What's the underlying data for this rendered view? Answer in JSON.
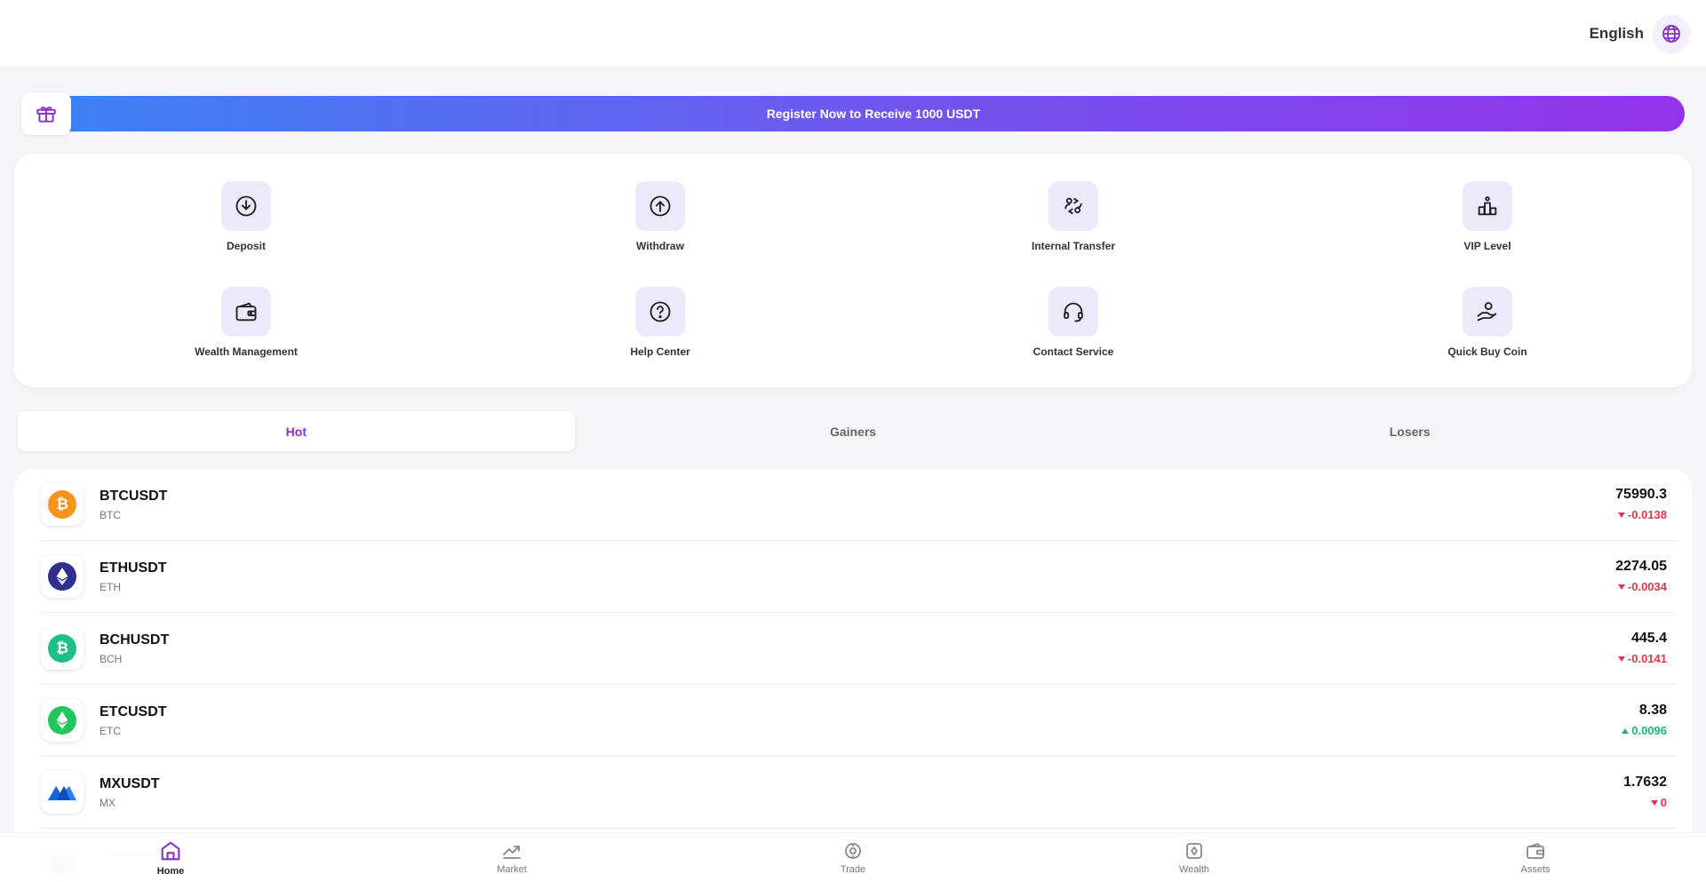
{
  "header": {
    "language": "English"
  },
  "banner": {
    "text": "Register Now to Receive 1000 USDT"
  },
  "actions": [
    {
      "label": "Deposit",
      "icon": "deposit-icon"
    },
    {
      "label": "Withdraw",
      "icon": "withdraw-icon"
    },
    {
      "label": "Internal Transfer",
      "icon": "transfer-icon"
    },
    {
      "label": "VIP Level",
      "icon": "vip-icon"
    },
    {
      "label": "Wealth Management",
      "icon": "wallet-icon"
    },
    {
      "label": "Help Center",
      "icon": "help-icon"
    },
    {
      "label": "Contact Service",
      "icon": "headset-icon"
    },
    {
      "label": "Quick Buy Coin",
      "icon": "buy-coin-icon"
    }
  ],
  "tabs": [
    {
      "label": "Hot",
      "active": true
    },
    {
      "label": "Gainers",
      "active": false
    },
    {
      "label": "Losers",
      "active": false
    }
  ],
  "markets": [
    {
      "symbol": "BTCUSDT",
      "base": "BTC",
      "price": "75990.3",
      "change": "-0.0138",
      "direction": "down",
      "color": "#f7931a"
    },
    {
      "symbol": "ETHUSDT",
      "base": "ETH",
      "price": "2274.05",
      "change": "-0.0034",
      "direction": "down",
      "color": "#2f2f8f"
    },
    {
      "symbol": "BCHUSDT",
      "base": "BCH",
      "price": "445.4",
      "change": "-0.0141",
      "direction": "down",
      "color": "#1dbf84"
    },
    {
      "symbol": "ETCUSDT",
      "base": "ETC",
      "price": "8.38",
      "change": "0.0096",
      "direction": "up",
      "color": "#22c55e"
    },
    {
      "symbol": "MXUSDT",
      "base": "MX",
      "price": "1.7632",
      "change": "0",
      "direction": "down",
      "color": "#1565d8"
    }
  ],
  "nav": [
    {
      "label": "Home",
      "active": true
    },
    {
      "label": "Market",
      "active": false
    },
    {
      "label": "Trade",
      "active": false
    },
    {
      "label": "Wealth",
      "active": false
    },
    {
      "label": "Assets",
      "active": false
    }
  ],
  "colors": {
    "accent": "#8b2fc9",
    "down": "#e0384a",
    "up": "#1fb37a"
  }
}
